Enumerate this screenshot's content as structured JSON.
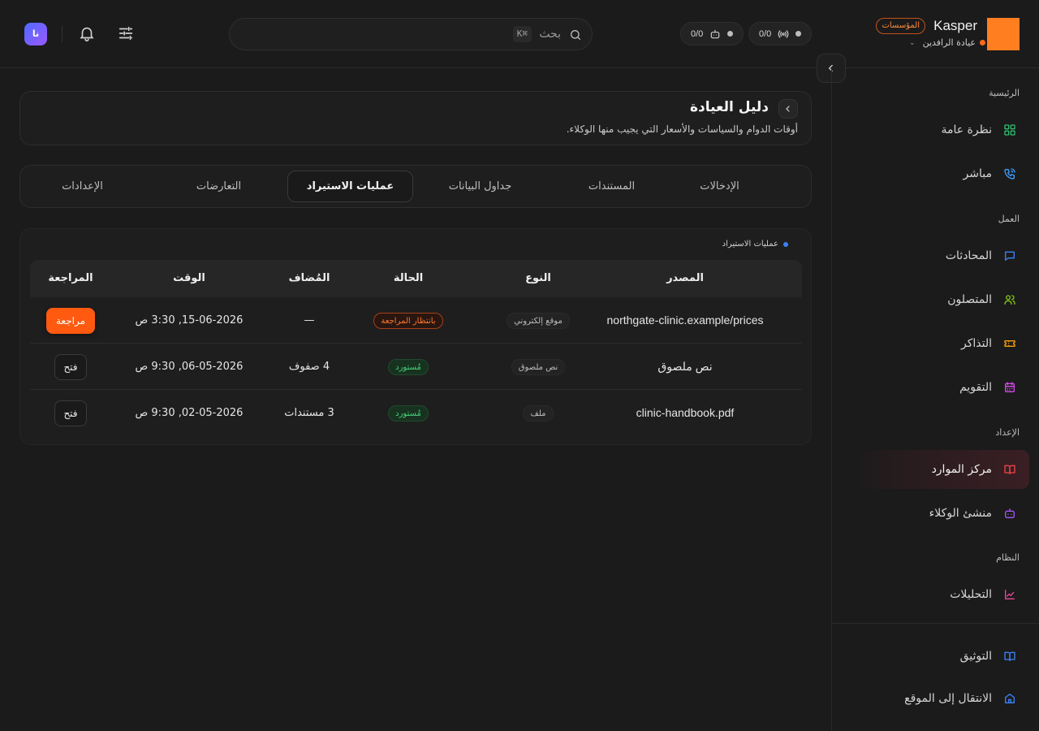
{
  "brand": {
    "name": "Kasper",
    "badge": "المؤسسات",
    "workspace": "عيادة الرافدين",
    "logo_color": "#ff7e20",
    "status_color": "#ff6a1a"
  },
  "topbar": {
    "stat_channels": "0/0",
    "stat_agents": "0/0",
    "search_label": "بحث",
    "search_shortcut": "⌘K",
    "avatar_initials": "نا"
  },
  "sidebar": {
    "sections": {
      "main": "الرئيسية",
      "work": "العمل",
      "setup": "الإعداد",
      "system": "النظام"
    },
    "items": [
      {
        "label": "نظرة عامة",
        "icon": "grid-icon",
        "color": "#2fbf71"
      },
      {
        "label": "مباشر",
        "icon": "phone-icon",
        "color": "#3aa0ff"
      },
      {
        "label": "المحادثات",
        "icon": "chat-icon",
        "color": "#3b82f6"
      },
      {
        "label": "المتصلون",
        "icon": "users-icon",
        "color": "#84cc16"
      },
      {
        "label": "التذاكر",
        "icon": "ticket-icon",
        "color": "#f59e0b"
      },
      {
        "label": "التقويم",
        "icon": "calendar-icon",
        "color": "#d946ef"
      },
      {
        "label": "مركز الموارد",
        "icon": "book-icon",
        "color": "#ef4444",
        "active": true
      },
      {
        "label": "منشئ الوكلاء",
        "icon": "bot-icon",
        "color": "#a855f7"
      },
      {
        "label": "التحليلات",
        "icon": "chart-icon",
        "color": "#ec4899"
      }
    ],
    "footer": [
      {
        "label": "التوثيق",
        "icon": "docs-icon",
        "color": "#3b82f6"
      },
      {
        "label": "الانتقال إلى الموقع",
        "icon": "home-icon",
        "color": "#3b82f6"
      }
    ]
  },
  "page": {
    "title": "دليل العيادة",
    "subtitle": "أوقات الدوام والسياسات والأسعار التي يجيب منها الوكلاء."
  },
  "tabs": [
    {
      "label": "الإدخالات"
    },
    {
      "label": "المستندات"
    },
    {
      "label": "جداول البيانات"
    },
    {
      "label": "عمليات الاستيراد",
      "active": true
    },
    {
      "label": "التعارضات"
    },
    {
      "label": "الإعدادات"
    }
  ],
  "imports": {
    "card_label": "عمليات الاستيراد",
    "columns": [
      "المصدر",
      "النوع",
      "الحالة",
      "المُضاف",
      "الوقت",
      "المراجعة"
    ],
    "rows": [
      {
        "source": "northgate-clinic.example/prices",
        "type": "موقع إلكتروني",
        "status": "بانتظار المراجعة",
        "status_kind": "pending",
        "added": "—",
        "time": "15-06-2026, 3:30 ص",
        "action": "مراجعة",
        "action_kind": "primary"
      },
      {
        "source": "نص ملصوق",
        "type": "نص ملصوق",
        "status": "مُستورد",
        "status_kind": "imported",
        "added": "4 صفوف",
        "time": "06-05-2026, 9:30 ص",
        "action": "فتح",
        "action_kind": "secondary"
      },
      {
        "source": "clinic-handbook.pdf",
        "type": "ملف",
        "status": "مُستورد",
        "status_kind": "imported",
        "added": "3 مستندات",
        "time": "02-05-2026, 9:30 ص",
        "action": "فتح",
        "action_kind": "secondary"
      }
    ]
  }
}
